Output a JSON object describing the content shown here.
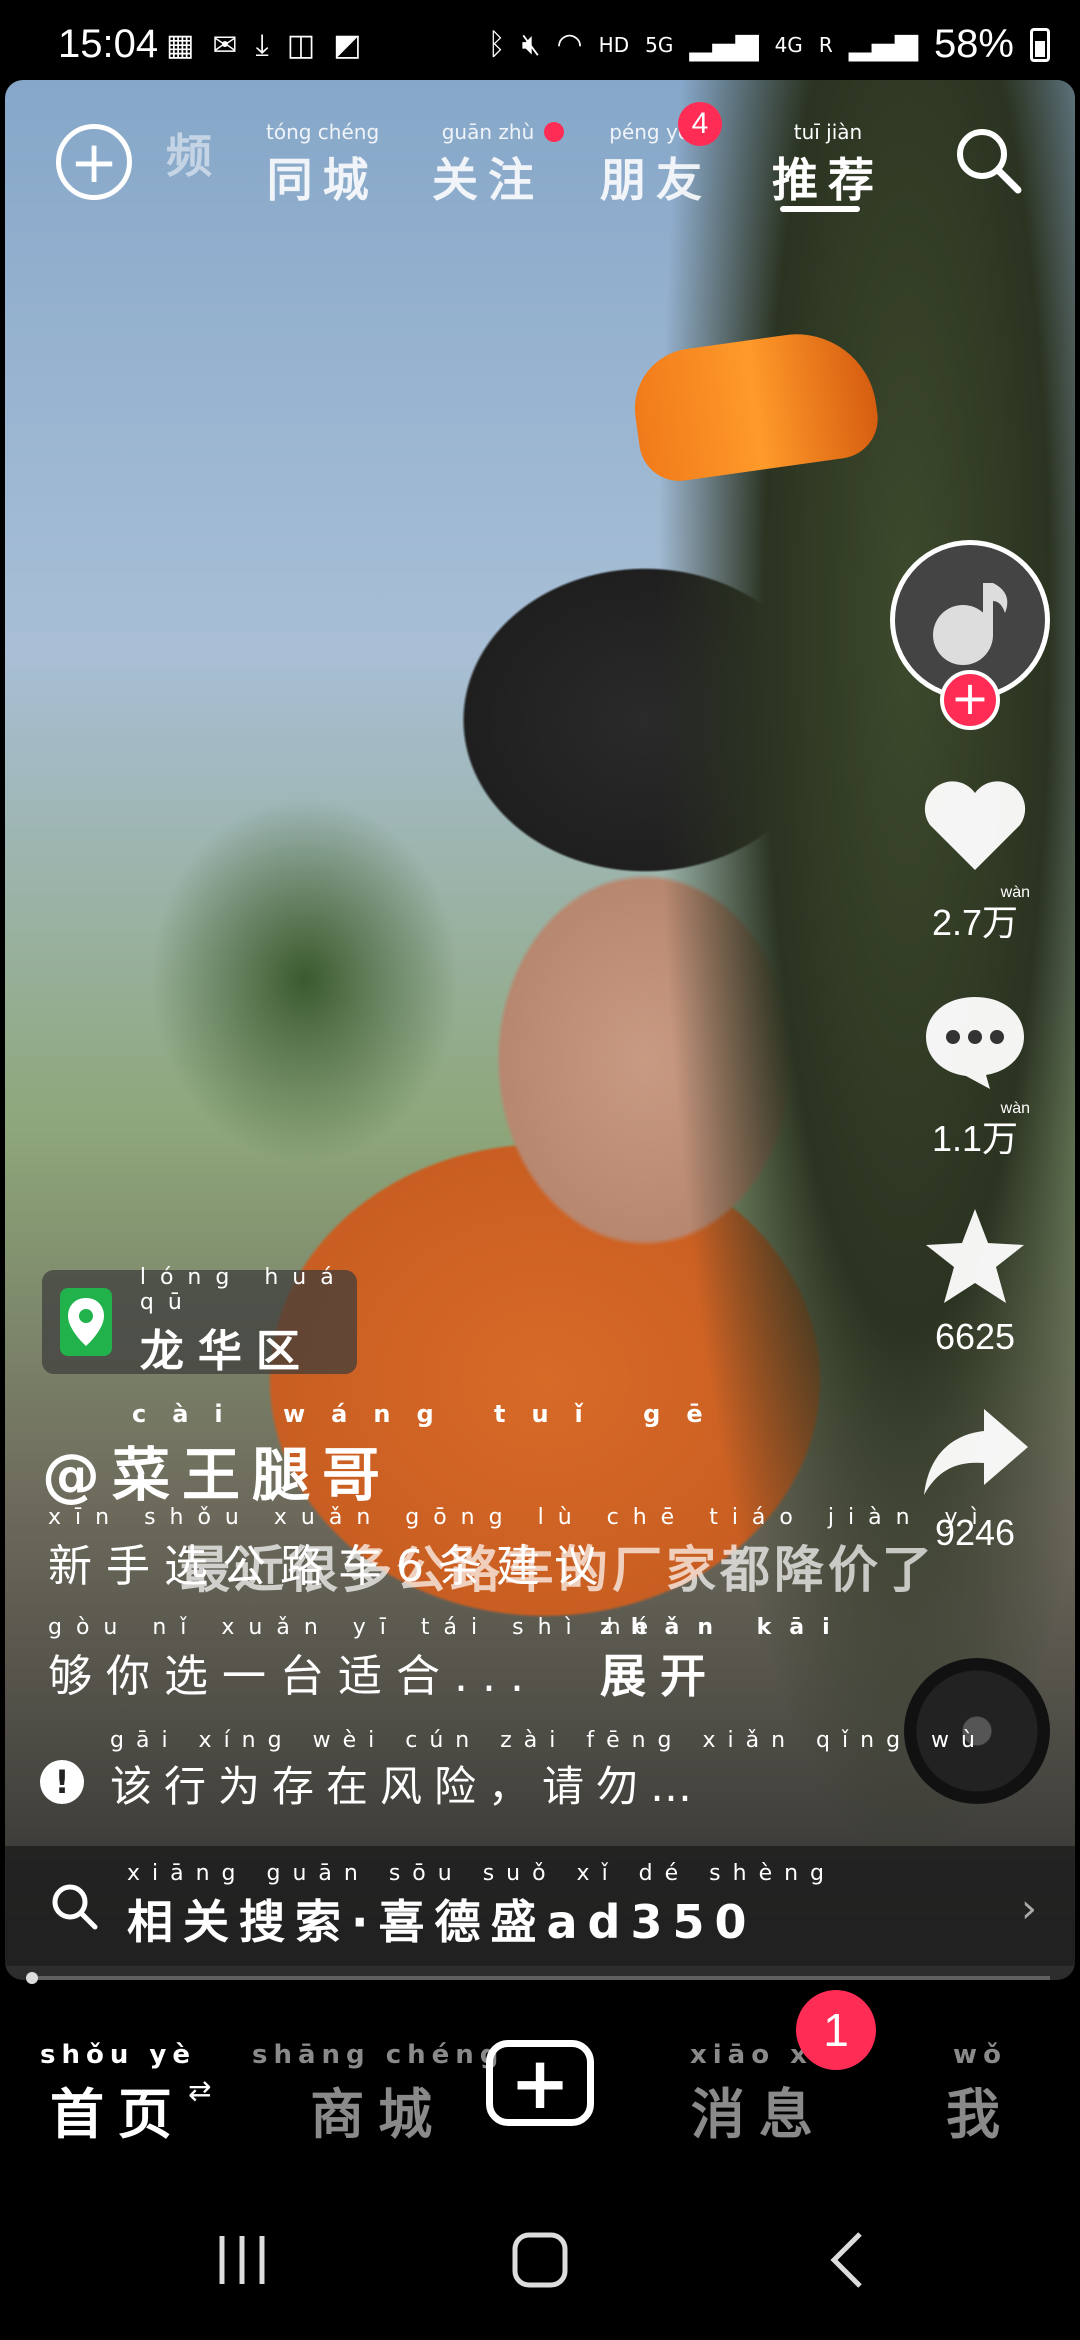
{
  "status_bar": {
    "time": "15:04",
    "network_hd": "HD",
    "network_5g": "5G",
    "network_4g": "4G",
    "roaming": "R",
    "battery": "58%"
  },
  "top_nav": {
    "tabs": [
      {
        "pinyin": "",
        "label": "频"
      },
      {
        "pinyin": "tóng chéng",
        "label": "同城"
      },
      {
        "pinyin": "guān zhù",
        "label": "关注"
      },
      {
        "pinyin": "péng yǒu",
        "label": "朋友"
      },
      {
        "pinyin": "tuī jiàn",
        "label": "推荐"
      }
    ],
    "friend_badge": "4"
  },
  "rail": {
    "likes": "2.7",
    "likes_unit": "万",
    "likes_unit_pinyin": "wàn",
    "comments": "1.1",
    "comments_unit": "万",
    "comments_unit_pinyin": "wàn",
    "favorites": "6625",
    "shares": "9246"
  },
  "location": {
    "pinyin": "lóng huá qū",
    "label": "龙华区"
  },
  "author": {
    "pinyin": "cài wáng tuǐ gē",
    "label": "@菜王腿哥"
  },
  "description": {
    "line1_pinyin": "xīn shǒu xuǎn gōng lù chē    tiáo jiàn yì",
    "line1": "新手选公路车6条建议",
    "line2_pinyin": "gòu nǐ xuǎn yī tái shì hé",
    "line2": "够你选一台适合...",
    "expand_pinyin": "zhǎn kāi",
    "expand": "展开"
  },
  "video_subtitle": "最近很多公路车的厂家都降价了",
  "warning": {
    "pinyin": "gāi xíng wèi cún zài fēng xiǎn   qǐng wù",
    "label": "该行为存在风险，请勿…"
  },
  "related_search": {
    "pinyin": "xiāng guān sōu suǒ   xǐ dé shèng",
    "label": "相关搜索·喜德盛ad350"
  },
  "video_progress": 0.0,
  "tab_bar": {
    "home_pinyin": "shǒu yè",
    "home": "首页",
    "mall_pinyin": "shāng chéng",
    "mall": "商城",
    "messages_pinyin": "xiāo xi",
    "messages": "消息",
    "messages_badge": "1",
    "me_pinyin": "wǒ",
    "me": "我"
  },
  "colors": {
    "accent": "#ff2d55",
    "location_green": "#22b24c"
  }
}
